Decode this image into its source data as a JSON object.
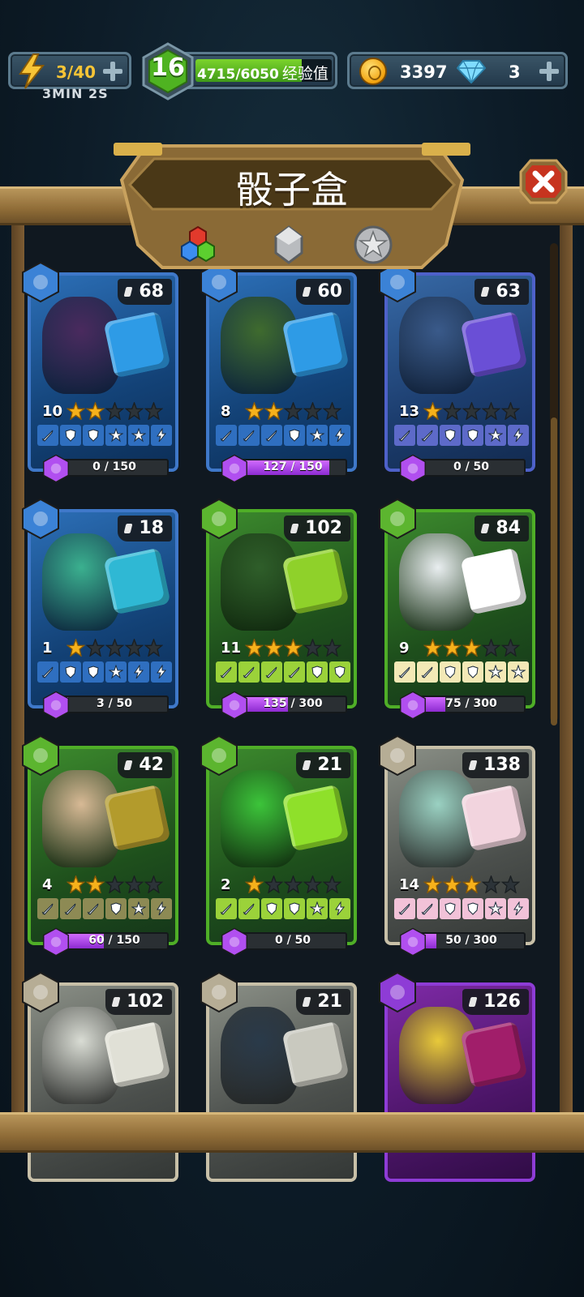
{
  "hud": {
    "energy": "3/40",
    "energy_timer": "3MIN 2S",
    "level": "16",
    "xp": "4715/6050",
    "xp_label": "经验值",
    "xp_progress": 0.779,
    "coins": "3397",
    "gems": "3"
  },
  "title": "骰子盒",
  "tabs": [
    "dice-tab",
    "gray-tab",
    "star-tab"
  ],
  "cards": [
    {
      "count": "68",
      "level": "10",
      "stars": 2,
      "progress": "0 / 150",
      "fill": 0.0,
      "element": "water",
      "style": "water"
    },
    {
      "count": "60",
      "level": "8",
      "stars": 2,
      "progress": "127 / 150",
      "fill": 0.847,
      "element": "water",
      "style": "water"
    },
    {
      "count": "63",
      "level": "13",
      "stars": 1,
      "progress": "0 / 50",
      "fill": 0.0,
      "element": "water",
      "style": "water-purple"
    },
    {
      "count": "18",
      "level": "1",
      "stars": 1,
      "progress": "3 / 50",
      "fill": 0.06,
      "element": "water",
      "style": "water"
    },
    {
      "count": "102",
      "level": "11",
      "stars": 3,
      "progress": "135 / 300",
      "fill": 0.45,
      "element": "nature",
      "style": "nature"
    },
    {
      "count": "84",
      "level": "9",
      "stars": 3,
      "progress": "75 / 300",
      "fill": 0.25,
      "element": "nature",
      "style": "nature"
    },
    {
      "count": "42",
      "level": "4",
      "stars": 2,
      "progress": "60 / 150",
      "fill": 0.4,
      "element": "nature",
      "style": "nature"
    },
    {
      "count": "21",
      "level": "2",
      "stars": 1,
      "progress": "0 / 50",
      "fill": 0.0,
      "element": "nature",
      "style": "nature"
    },
    {
      "count": "138",
      "level": "14",
      "stars": 3,
      "progress": "50 / 300",
      "fill": 0.167,
      "element": "earth",
      "style": "earth"
    },
    {
      "count": "102",
      "element": "earth",
      "style": "earth"
    },
    {
      "count": "21",
      "element": "earth",
      "style": "earth"
    },
    {
      "count": "126",
      "element": "void",
      "style": "void"
    }
  ],
  "colors": {
    "water": "#2c6fb7",
    "nature": "#4fae27",
    "earth": "#b6ad95",
    "void": "#8e3cd6",
    "progress": "#b14ff0",
    "star_on": "#f6b11b",
    "star_off": "#2c3338"
  }
}
